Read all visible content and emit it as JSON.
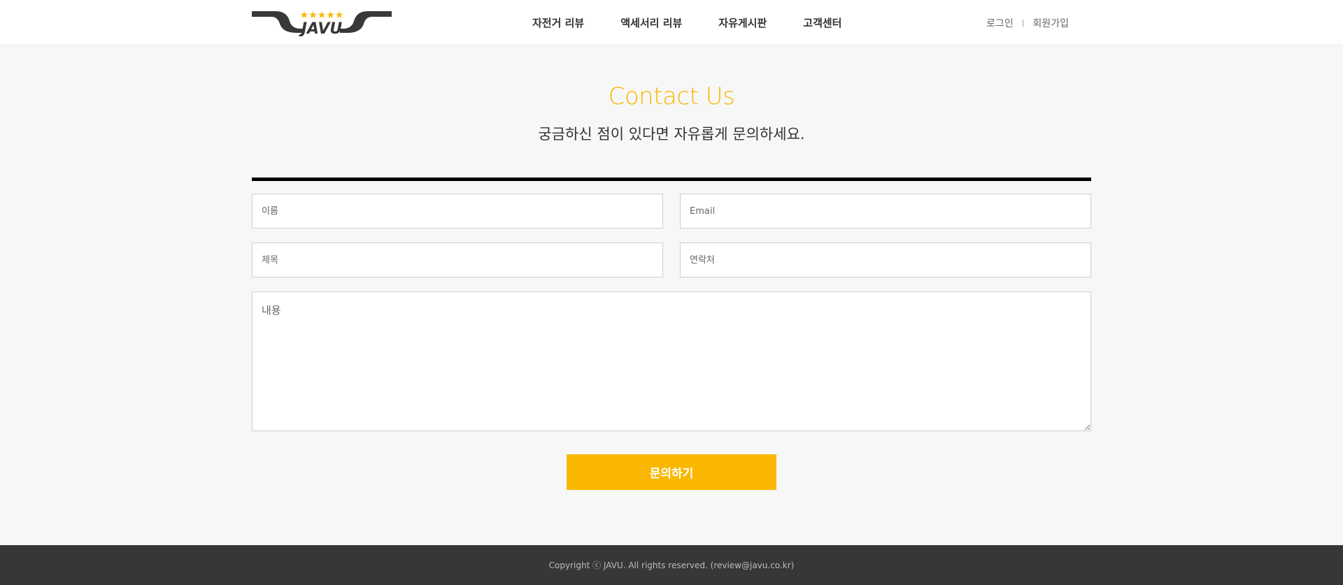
{
  "brand": {
    "logo_text": "JAVU",
    "logo_stars": "★★★★★",
    "accent_color": "#f9b700"
  },
  "nav": {
    "items": [
      {
        "label": "자전거 리뷰"
      },
      {
        "label": "액세서리 리뷰"
      },
      {
        "label": "자유게시판"
      },
      {
        "label": "고객센터"
      }
    ]
  },
  "auth": {
    "login": "로그인",
    "separator": "|",
    "signup": "회원가입"
  },
  "page": {
    "title": "Contact Us",
    "subtitle": "궁금하신 점이 있다면 자유롭게 문의하세요."
  },
  "form": {
    "name_placeholder": "이름",
    "email_placeholder": "Email",
    "subject_placeholder": "제목",
    "phone_placeholder": "연락처",
    "content_placeholder": "내용",
    "submit_label": "문의하기"
  },
  "footer": {
    "copyright": "Copyright ⓒ JAVU. All rights reserved. (review@javu.co.kr)"
  }
}
